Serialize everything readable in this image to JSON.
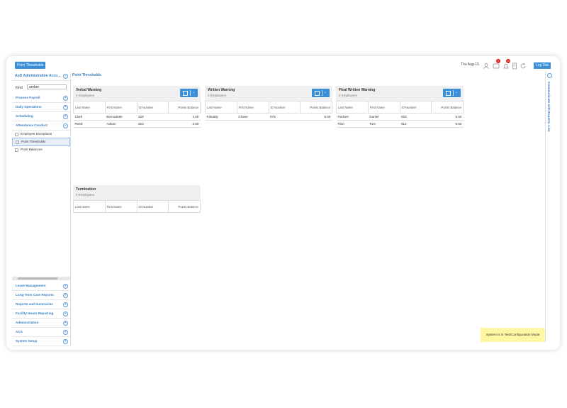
{
  "topbar": {
    "tab_chip": "Point Thresholds",
    "date": "Thu Aug-15",
    "badge_a": "2",
    "badge_b": "14",
    "logout_label": "Log Out"
  },
  "sidebar": {
    "header": "AoD Administration Acco...",
    "find_label": "Find",
    "find_value": "amber",
    "sections_top": [
      "Process Payroll",
      "Daily Operations",
      "Scheduling",
      "Attendance Conduct"
    ],
    "sub_items": [
      "Employee Exceptions",
      "Point Thresholds",
      "Point Balances"
    ],
    "sections_bottom": [
      "Leave Management",
      "Long-Term Care Reports",
      "Reports and Summaries",
      "Facility Hours Reporting",
      "Administration",
      "ACA",
      "System Setup"
    ]
  },
  "main": {
    "breadcrumb": "Point Thresholds",
    "columns": [
      "Last Name",
      "First Name",
      "ID Number",
      "Points Balance"
    ],
    "cards": [
      {
        "title": "Verbal Warning",
        "subtitle": "2 Employees",
        "rows": [
          [
            "Clark",
            "Bernadette",
            "329",
            "4.00"
          ],
          [
            "Reed",
            "Adrian",
            "323",
            "4.50"
          ]
        ]
      },
      {
        "title": "Written Warning",
        "subtitle": "1 Employees",
        "rows": [
          [
            "Kirkaldy",
            "Chase",
            "578",
            "6.00"
          ]
        ]
      },
      {
        "title": "Final Written Warning",
        "subtitle": "2 Employees",
        "rows": [
          [
            "Herbert",
            "Daniel",
            "533",
            "9.50"
          ],
          [
            "Rion",
            "Tom",
            "612",
            "9.50"
          ]
        ]
      },
      {
        "title": "Termination",
        "subtitle": "0 Employees",
        "rows": []
      }
    ]
  },
  "rightbar": {
    "label": "Communicate with Experts, Live"
  },
  "status": {
    "test_mode": "System is in Test/Configuration Mode"
  }
}
